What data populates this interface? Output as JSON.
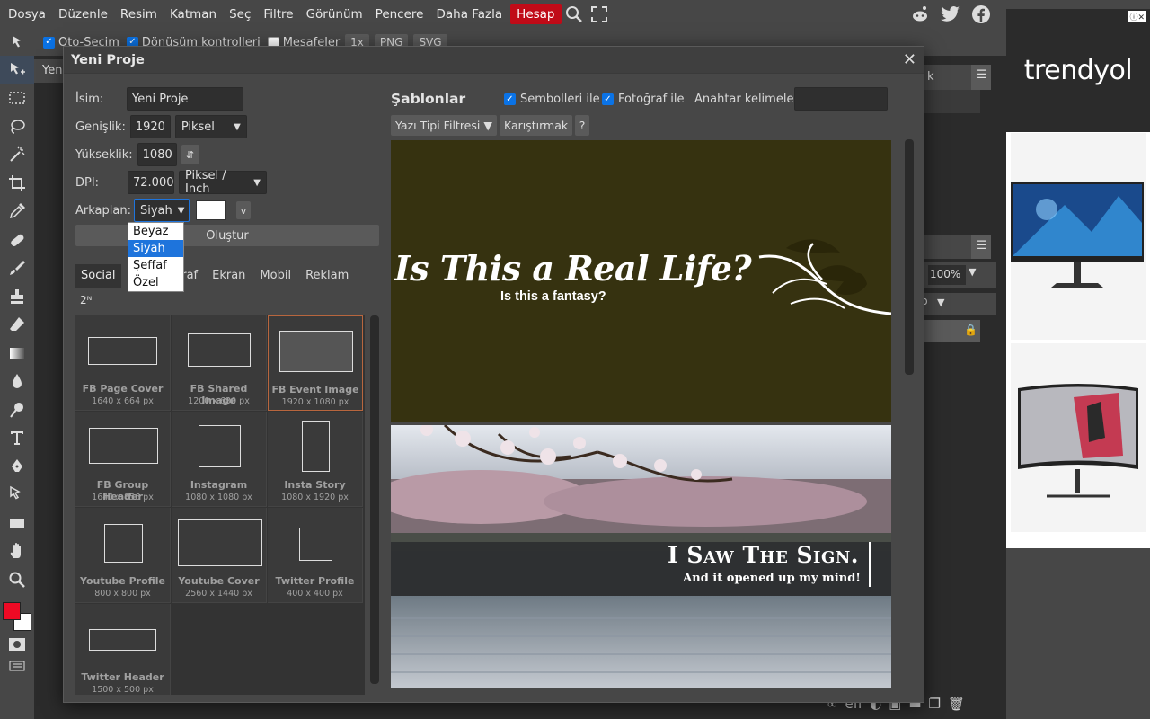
{
  "menu": {
    "items": [
      "Dosya",
      "Düzenle",
      "Resim",
      "Katman",
      "Seç",
      "Filtre",
      "Görünüm",
      "Pencere",
      "Daha Fazla"
    ],
    "account": "Hesap"
  },
  "options_bar": {
    "auto_select": "Oto-Seçim",
    "transform_controls": "Dönüşüm kontrolleri",
    "distances": "Mesafeler",
    "zoom": "1x",
    "png": "PNG",
    "svg": "SVG"
  },
  "workspace": {
    "tab_stub": "Yen",
    "right_panel_k": "k",
    "zoom": "100%",
    "panel_p": "p"
  },
  "ad": {
    "brand": "trendyol",
    "info": "ⓘ✕"
  },
  "dialog": {
    "title": "Yeni Proje",
    "close": "✕",
    "name_label": "İsim:",
    "name_value": "Yeni Proje",
    "width_label": "Genişlik:",
    "width_value": "1920",
    "unit": "Piksel",
    "height_label": "Yükseklik:",
    "height_value": "1080",
    "swap_icon": "⇵",
    "dpi_label": "DPI:",
    "dpi_value": "72.000",
    "dpi_unit": "Piksel / Inch",
    "background_label": "Arkaplan:",
    "background_value": "Siyah",
    "background_color": "#ffffff",
    "v_button": "v",
    "background_options": [
      "Beyaz",
      "Siyah",
      "Şeffaf",
      "Özel"
    ],
    "background_selected": "Siyah",
    "create_button": "Oluştur",
    "categories": [
      "Social",
      "F",
      "oğraf",
      "Ekran",
      "Mobil",
      "Reklam"
    ],
    "two_n": "2ᴺ",
    "presets": [
      {
        "name": "FB Page Cover",
        "size": "1640 x 664 px"
      },
      {
        "name": "FB Shared Image",
        "size": "1200 x 630 px"
      },
      {
        "name": "FB Event Image",
        "size": "1920 x 1080 px"
      },
      {
        "name": "FB Group Header",
        "size": "1640 x 856 px"
      },
      {
        "name": "Instagram",
        "size": "1080 x 1080 px"
      },
      {
        "name": "Insta Story",
        "size": "1080 x 1920 px"
      },
      {
        "name": "Youtube Profile",
        "size": "800 x 800 px"
      },
      {
        "name": "Youtube Cover",
        "size": "2560 x 1440 px"
      },
      {
        "name": "Twitter Profile",
        "size": "400 x 400 px"
      },
      {
        "name": "Twitter Header",
        "size": "1500 x 500 px"
      }
    ],
    "selected_preset": "FB Event Image",
    "templates_title": "Şablonlar",
    "with_symbols": "Sembolleri ile",
    "with_photos": "Fotoğraf ile",
    "keywords_label": "Anahtar kelimeler:",
    "font_filter": "Yazı Tipi Filtresi ▼",
    "shuffle": "Karıştırmak",
    "help": "?",
    "template1": {
      "headline": "Is This a Real Life?",
      "subline": "Is this a fantasy?"
    },
    "template2": {
      "headline": "I Saw The Sign.",
      "subline": "And it opened up my mind!"
    }
  },
  "colors": {
    "accent": "#1e74dc",
    "account": "#c00b18",
    "foreground": "#ee0a24",
    "background": "#ffffff"
  }
}
